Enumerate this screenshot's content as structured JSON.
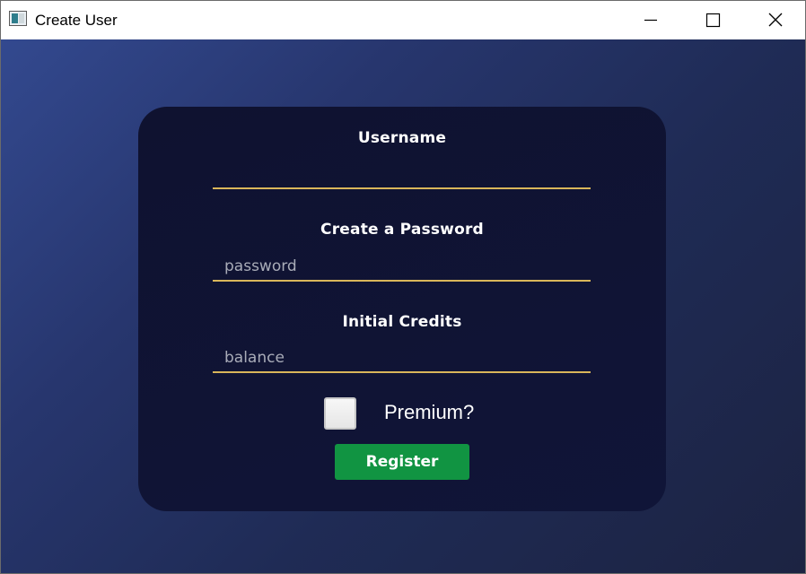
{
  "window": {
    "title": "Create User",
    "controls": [
      "minimize",
      "maximize",
      "close"
    ]
  },
  "colors": {
    "card_background": "#0f1230",
    "input_underline": "#d9b65a",
    "register_button": "#119442",
    "gradient_start": "#33498f",
    "gradient_end": "#1c2342"
  },
  "form": {
    "username": {
      "label": "Username",
      "value": "",
      "placeholder": ""
    },
    "password": {
      "label": "Create a Password",
      "value": "",
      "placeholder": "password"
    },
    "credits": {
      "label": "Initial Credits",
      "value": "",
      "placeholder": "balance"
    },
    "premium": {
      "label": "Premium?",
      "checked": false
    },
    "register_label": "Register"
  }
}
